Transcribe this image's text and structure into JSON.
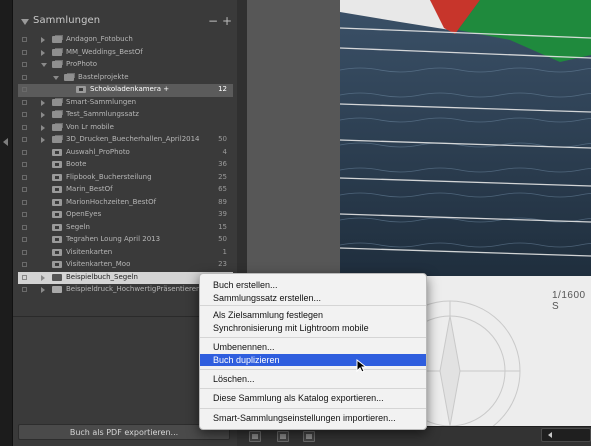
{
  "panel": {
    "title": "Sammlungen",
    "minus": "−",
    "plus": "+",
    "items": [
      {
        "label": "Andagon_Fotobuch",
        "count": "",
        "level": 2,
        "type": "set",
        "expand": "closed"
      },
      {
        "label": "MM_Weddings_BestOf",
        "count": "",
        "level": 2,
        "type": "set",
        "expand": "closed"
      },
      {
        "label": "ProPhoto",
        "count": "",
        "level": 2,
        "type": "set",
        "expand": "open"
      },
      {
        "label": "Bastelprojekte",
        "count": "",
        "level": 3,
        "type": "set",
        "expand": "open"
      },
      {
        "label": "Schokoladenkamera +",
        "count": "12",
        "level": 4,
        "type": "collection",
        "expand": "none",
        "state": "active"
      },
      {
        "label": "Smart-Sammlungen",
        "count": "",
        "level": 2,
        "type": "set",
        "expand": "closed"
      },
      {
        "label": "Test_Sammlungssatz",
        "count": "",
        "level": 2,
        "type": "set",
        "expand": "closed"
      },
      {
        "label": "Von Lr mobile",
        "count": "",
        "level": 2,
        "type": "set",
        "expand": "closed"
      },
      {
        "label": "3D_Drucken_Buecherhallen_April2014",
        "count": "50",
        "level": 2,
        "type": "set",
        "expand": "closed"
      },
      {
        "label": "Auswahl_ProPhoto",
        "count": "4",
        "level": 1,
        "type": "collection",
        "expand": "none"
      },
      {
        "label": "Boote",
        "count": "36",
        "level": 1,
        "type": "collection",
        "expand": "none"
      },
      {
        "label": "Flipbook_Buchersteilung",
        "count": "25",
        "level": 1,
        "type": "collection",
        "expand": "none"
      },
      {
        "label": "Marin_BestOf",
        "count": "65",
        "level": 1,
        "type": "collection",
        "expand": "none"
      },
      {
        "label": "MarionHochzeiten_BestOf",
        "count": "89",
        "level": 1,
        "type": "collection",
        "expand": "none"
      },
      {
        "label": "OpenEyes",
        "count": "39",
        "level": 1,
        "type": "collection",
        "expand": "none"
      },
      {
        "label": "Segeln",
        "count": "15",
        "level": 1,
        "type": "collection",
        "expand": "none"
      },
      {
        "label": "Tegrahen Loung April 2013",
        "count": "50",
        "level": 1,
        "type": "collection",
        "expand": "none"
      },
      {
        "label": "Visitenkarten",
        "count": "1",
        "level": 1,
        "type": "collection",
        "expand": "none"
      },
      {
        "label": "Visitenkarten_Moo",
        "count": "23",
        "level": 1,
        "type": "collection",
        "expand": "none"
      },
      {
        "label": "Beispielbuch_Segeln",
        "count": "",
        "level": 2,
        "type": "book",
        "expand": "closed",
        "state": "selected"
      },
      {
        "label": "Beispieldruck_HochwertigPräsentieren",
        "count": "",
        "level": 2,
        "type": "print",
        "expand": "closed"
      }
    ],
    "pdf_button": "Buch als PDF exportieren..."
  },
  "preview": {
    "shutter_text": "1/1600 S"
  },
  "context_menu": {
    "items": [
      {
        "label": "Buch erstellen...",
        "highlighted": false
      },
      {
        "label": "Sammlungssatz erstellen...",
        "highlighted": false
      },
      {
        "label": "Als Zielsammlung festlegen",
        "highlighted": false
      },
      {
        "label": "Synchronisierung mit Lightroom mobile",
        "highlighted": false
      },
      {
        "label": "Umbenennen...",
        "highlighted": false
      },
      {
        "label": "Buch duplizieren",
        "highlighted": true
      },
      {
        "label": "Löschen...",
        "highlighted": false
      },
      {
        "label": "Diese Sammlung als Katalog exportieren...",
        "highlighted": false
      },
      {
        "label": "Smart-Sammlungseinstellungen importieren...",
        "highlighted": false
      }
    ]
  },
  "colors": {
    "panel_bg": "#3a3a3a",
    "menu_highlight": "#2f5ede",
    "selected_row": "#d4d4d4"
  }
}
